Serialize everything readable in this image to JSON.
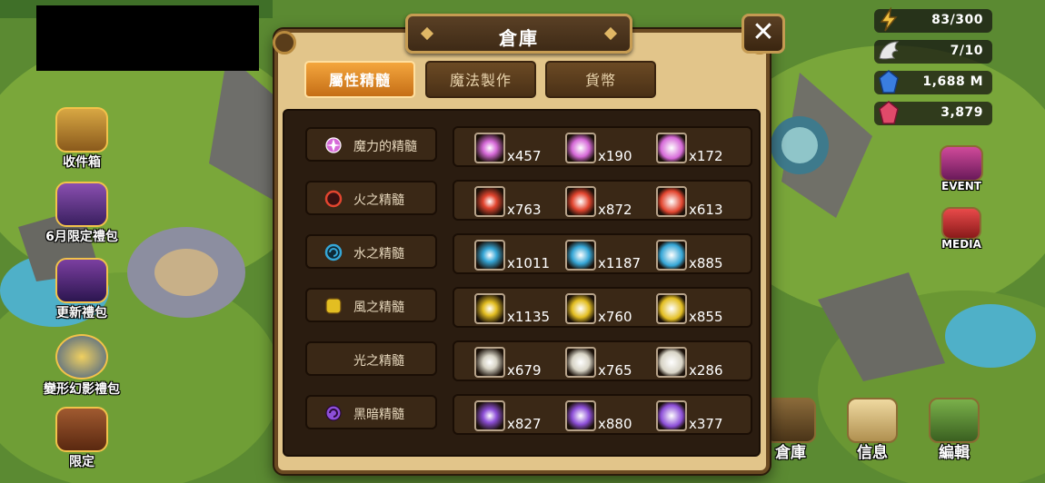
{
  "window": {
    "title": "倉庫",
    "close_label": "✕",
    "tabs": [
      {
        "label": "屬性精髓",
        "active": true
      },
      {
        "label": "魔法製作",
        "active": false
      },
      {
        "label": "貨幣",
        "active": false
      }
    ],
    "essences": [
      {
        "name": "魔力的精髓",
        "color": "#d66ad8",
        "icon": "magic-essence-icon",
        "items": [
          {
            "qty": "x457"
          },
          {
            "qty": "x190"
          },
          {
            "qty": "x172"
          }
        ]
      },
      {
        "name": "火之精髓",
        "color": "#e2452f",
        "icon": "fire-essence-icon",
        "items": [
          {
            "qty": "x763"
          },
          {
            "qty": "x872"
          },
          {
            "qty": "x613"
          }
        ]
      },
      {
        "name": "水之精髓",
        "color": "#35a6d6",
        "icon": "water-essence-icon",
        "items": [
          {
            "qty": "x1011"
          },
          {
            "qty": "x1187"
          },
          {
            "qty": "x885"
          }
        ]
      },
      {
        "name": "風之精髓",
        "color": "#e3be22",
        "icon": "wind-essence-icon",
        "items": [
          {
            "qty": "x1135"
          },
          {
            "qty": "x760"
          },
          {
            "qty": "x855"
          }
        ]
      },
      {
        "name": "光之精髓",
        "color": "#d8d4c6",
        "icon": "light-essence-icon",
        "items": [
          {
            "qty": "x679"
          },
          {
            "qty": "x765"
          },
          {
            "qty": "x286"
          }
        ]
      },
      {
        "name": "黑暗精髓",
        "color": "#8d4fd8",
        "icon": "dark-essence-icon",
        "items": [
          {
            "qty": "x827"
          },
          {
            "qty": "x880"
          },
          {
            "qty": "x377"
          }
        ]
      }
    ]
  },
  "left_menu": [
    {
      "label": "收件箱",
      "icon": "inbox-chest-icon"
    },
    {
      "label": "6月限定禮包",
      "icon": "gift-pack-icon"
    },
    {
      "label": "更新禮包",
      "icon": "update-pack-icon"
    },
    {
      "label": "變形幻影禮包",
      "icon": "transmog-pack-icon"
    },
    {
      "label": "限定",
      "icon": "limited-pack-icon"
    }
  ],
  "resources": [
    {
      "icon": "energy-icon",
      "value": "83/300",
      "color": "#f0c040"
    },
    {
      "icon": "wing-icon",
      "value": "7/10",
      "color": "#e8e8e8"
    },
    {
      "icon": "mana-crystal-icon",
      "value": "1,688 M",
      "color": "#3a7ee0"
    },
    {
      "icon": "gem-icon",
      "value": "3,879",
      "color": "#e04a6a"
    }
  ],
  "right_buttons": [
    {
      "label": "EVENT",
      "icon": "event-icon"
    },
    {
      "label": "MEDIA",
      "icon": "media-icon"
    }
  ],
  "bottom_buttons": [
    {
      "label": "倉庫",
      "icon": "storage-icon"
    },
    {
      "label": "信息",
      "icon": "info-scroll-icon"
    },
    {
      "label": "編輯",
      "icon": "edit-island-icon"
    }
  ]
}
